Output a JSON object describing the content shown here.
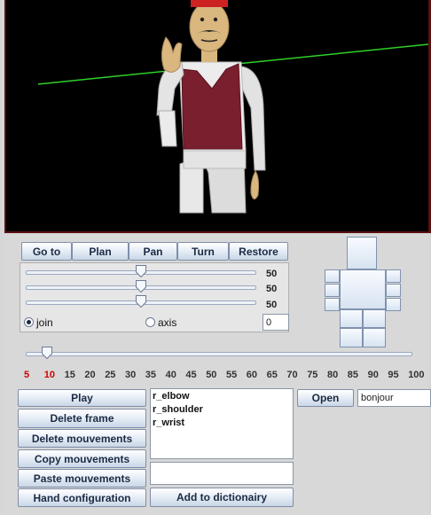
{
  "toolbar": {
    "goto": "Go to",
    "plan": "Plan",
    "pan": "Pan",
    "turn": "Turn",
    "restore": "Restore"
  },
  "sliders": [
    {
      "value": "50",
      "level": 50
    },
    {
      "value": "50",
      "level": 50
    },
    {
      "value": "50",
      "level": 50
    }
  ],
  "mode": {
    "join_label": "join",
    "axis_label": "axis",
    "selected": "join",
    "number_value": "0"
  },
  "timeline": {
    "ticks": [
      "5",
      "10",
      "15",
      "20",
      "25",
      "30",
      "35",
      "40",
      "45",
      "50",
      "55",
      "60",
      "65",
      "70",
      "75",
      "80",
      "85",
      "90",
      "95",
      "100"
    ],
    "highlighted": [
      "5",
      "10"
    ],
    "position": 10
  },
  "actions": {
    "play": "Play",
    "delete_frame": "Delete frame",
    "delete_mouvements": "Delete mouvements",
    "copy_mouvements": "Copy mouvements",
    "paste_mouvements": "Paste mouvements",
    "hand_configuration": "Hand configuration",
    "add_to_dictionary": "Add to dictionairy"
  },
  "joints": [
    "r_elbow",
    "r_shoulder",
    "r_wrist"
  ],
  "file": {
    "open_label": "Open",
    "name_value": "bonjour"
  },
  "colors": {
    "accent_red": "#d40000",
    "vest": "#7a1f2e",
    "button_text": "#1b2a44"
  }
}
